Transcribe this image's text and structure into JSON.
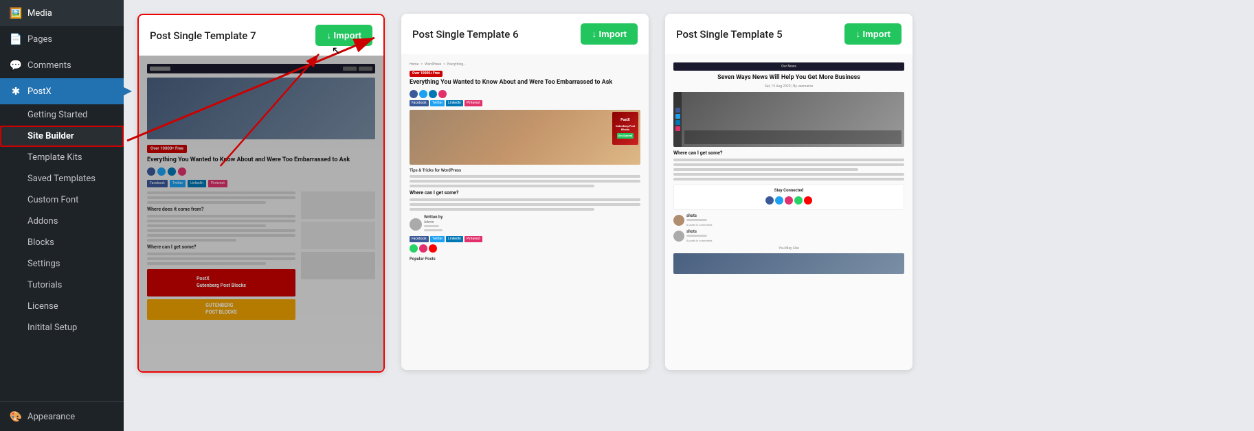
{
  "sidebar": {
    "items": [
      {
        "id": "media",
        "label": "Media",
        "icon": "🖼️"
      },
      {
        "id": "pages",
        "label": "Pages",
        "icon": "📄"
      },
      {
        "id": "comments",
        "label": "Comments",
        "icon": "💬"
      },
      {
        "id": "postx",
        "label": "PostX",
        "icon": "✱",
        "active": true
      },
      {
        "id": "getting-started",
        "label": "Getting Started",
        "sub": true
      },
      {
        "id": "site-builder",
        "label": "Site Builder",
        "sub": true,
        "highlighted": true
      },
      {
        "id": "template-kits",
        "label": "Template Kits",
        "sub": true
      },
      {
        "id": "saved-templates",
        "label": "Saved Templates",
        "sub": true
      },
      {
        "id": "custom-font",
        "label": "Custom Font",
        "sub": true
      },
      {
        "id": "addons",
        "label": "Addons",
        "sub": true
      },
      {
        "id": "blocks",
        "label": "Blocks",
        "sub": true
      },
      {
        "id": "settings",
        "label": "Settings",
        "sub": true
      },
      {
        "id": "tutorials",
        "label": "Tutorials",
        "sub": true
      },
      {
        "id": "license",
        "label": "License",
        "sub": true
      },
      {
        "id": "initial-setup",
        "label": "Initital Setup",
        "sub": true
      }
    ],
    "bottom": [
      {
        "id": "appearance",
        "label": "Appearance",
        "icon": "🎨"
      }
    ]
  },
  "templates": [
    {
      "id": "template-7",
      "title": "Post Single Template 7",
      "import_label": "↓ Import",
      "highlighted": true
    },
    {
      "id": "template-6",
      "title": "Post Single Template 6",
      "import_label": "↓ Import",
      "highlighted": false
    },
    {
      "id": "template-5",
      "title": "Post Single Template 5",
      "import_label": "↓ Import",
      "highlighted": false
    }
  ]
}
